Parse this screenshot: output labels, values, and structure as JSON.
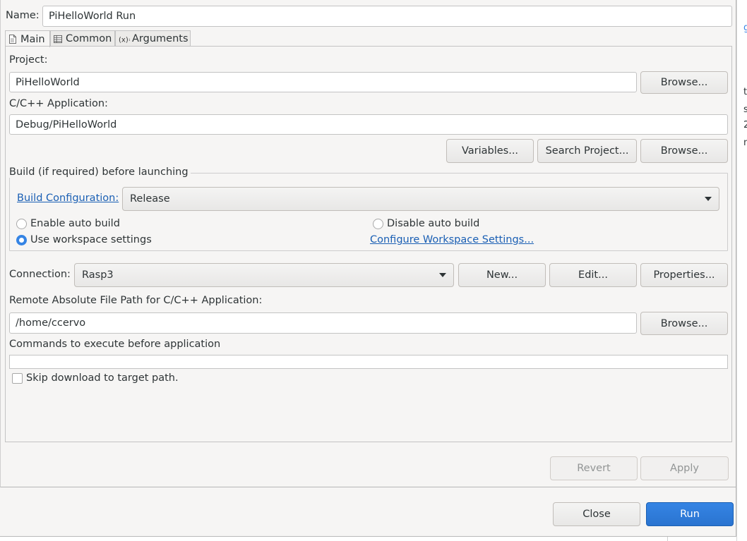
{
  "background_fragments": [
    "g",
    "t",
    "s",
    "2",
    "n"
  ],
  "name": {
    "label": "Name:",
    "value": "PiHelloWorld Run"
  },
  "tabs": [
    {
      "label": "Main",
      "icon": "document-icon"
    },
    {
      "label": "Common",
      "icon": "table-icon"
    },
    {
      "label": "Arguments",
      "icon": "variables-icon"
    }
  ],
  "main": {
    "project_label": "Project:",
    "project_value": "PiHelloWorld",
    "browse_label": "Browse...",
    "app_label": "C/C++ Application:",
    "app_value": "Debug/PiHelloWorld",
    "variables_label": "Variables...",
    "search_project_label": "Search Project...",
    "build": {
      "group_title": "Build (if required) before launching",
      "config_link": "Build Configuration:",
      "config_value": "Release",
      "enable_auto": "Enable auto build",
      "disable_auto": "Disable auto build",
      "use_workspace": "Use workspace settings",
      "configure_link": "Configure Workspace Settings...",
      "selected": "Use workspace settings"
    },
    "connection_label": "Connection:",
    "connection_value": "Rasp3",
    "new_label": "New...",
    "edit_label": "Edit...",
    "properties_label": "Properties...",
    "remote_path_label": "Remote Absolute File Path for C/C++ Application:",
    "remote_path_value": "/home/ccervo",
    "commands_label": "Commands to execute before application",
    "commands_value": "",
    "skip_download_label": "Skip download to target path.",
    "skip_download_checked": false
  },
  "footer": {
    "revert_label": "Revert",
    "apply_label": "Apply",
    "close_label": "Close",
    "run_label": "Run"
  },
  "colors": {
    "accent": "#3584e4",
    "link": "#1a5fb4"
  }
}
